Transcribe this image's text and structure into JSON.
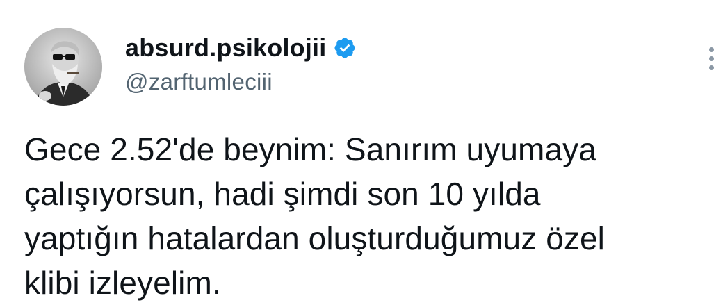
{
  "author": {
    "display_name": "absurd.psikolojii",
    "handle": "@zarftumleciii",
    "verified": true,
    "avatar_icon": "avatar-portrait-sunglasses"
  },
  "tweet": {
    "text": "Gece 2.52'de beynim: Sanırım uyumaya\nçalışıyorsun, hadi şimdi son 10 yılda\nyaptığın hatalardan oluşturduğumuz özel\nklibi izleyelim."
  },
  "icons": {
    "verified": "verified-badge-icon",
    "more": "more-options-icon"
  },
  "colors": {
    "verified_blue": "#1d9bf0",
    "handle_gray": "#536471",
    "text": "#0f1419"
  }
}
